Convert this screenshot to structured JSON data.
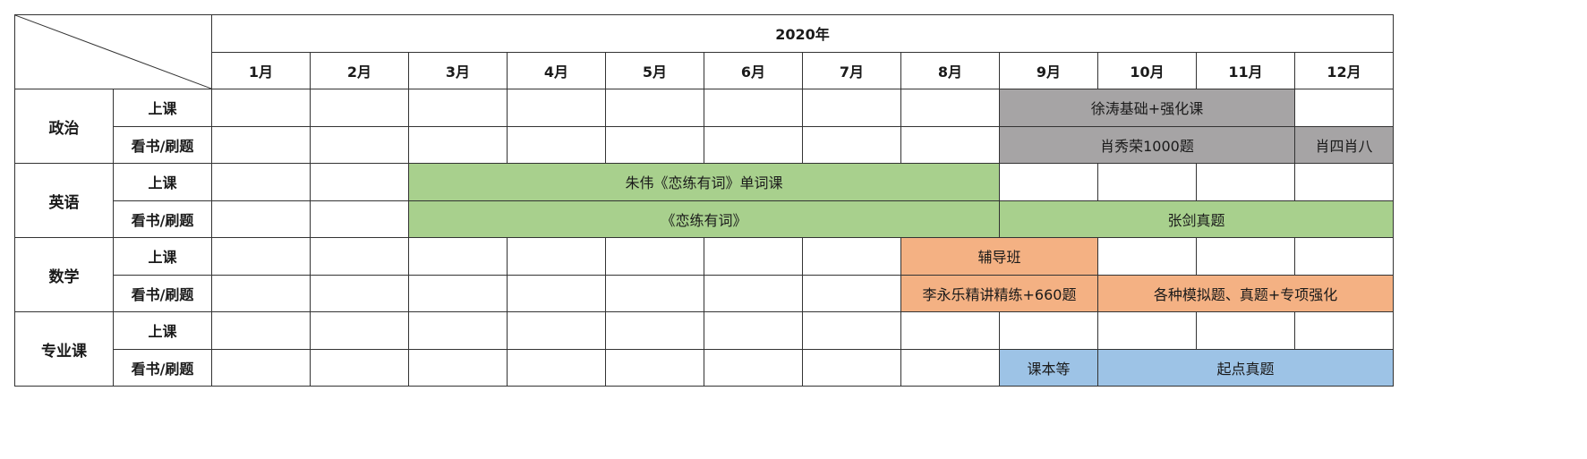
{
  "year": "2020年",
  "months": [
    "1月",
    "2月",
    "3月",
    "4月",
    "5月",
    "6月",
    "7月",
    "8月",
    "9月",
    "10月",
    "11月",
    "12月"
  ],
  "row_labels": {
    "class": "上课",
    "study": "看书/刷题"
  },
  "subjects": [
    {
      "name": "政治",
      "rows": [
        {
          "cells": [
            null,
            null,
            null,
            null,
            null,
            null,
            null,
            null,
            {
              "text": "徐涛基础+强化课",
              "span": 3,
              "color": "#a6a4a5"
            },
            null
          ]
        },
        {
          "cells": [
            null,
            null,
            null,
            null,
            null,
            null,
            null,
            null,
            {
              "text": "肖秀荣1000题",
              "span": 3,
              "color": "#a6a4a5"
            },
            {
              "text": "肖四肖八",
              "span": 1,
              "color": "#a6a4a5"
            }
          ]
        }
      ]
    },
    {
      "name": "英语",
      "rows": [
        {
          "cells": [
            null,
            null,
            {
              "text": "朱伟《恋练有词》单词课",
              "span": 6,
              "color": "#a8d08d"
            },
            null,
            null,
            null,
            null
          ]
        },
        {
          "cells": [
            null,
            null,
            {
              "text": "《恋练有词》",
              "span": 6,
              "color": "#a8d08d"
            },
            {
              "text": "张剑真题",
              "span": 4,
              "color": "#a8d08d"
            }
          ]
        }
      ]
    },
    {
      "name": "数学",
      "rows": [
        {
          "cells": [
            null,
            null,
            null,
            null,
            null,
            null,
            null,
            {
              "text": "辅导班",
              "span": 2,
              "color": "#f4b183"
            },
            null,
            null,
            null
          ]
        },
        {
          "cells": [
            null,
            null,
            null,
            null,
            null,
            null,
            null,
            {
              "text": "李永乐精讲精练+660题",
              "span": 2,
              "color": "#f4b183"
            },
            {
              "text": "各种模拟题、真题+专项强化",
              "span": 3,
              "color": "#f4b183"
            }
          ]
        }
      ]
    },
    {
      "name": "专业课",
      "rows": [
        {
          "cells": [
            null,
            null,
            null,
            null,
            null,
            null,
            null,
            null,
            null,
            null,
            null,
            null
          ]
        },
        {
          "cells": [
            null,
            null,
            null,
            null,
            null,
            null,
            null,
            null,
            {
              "text": "课本等",
              "span": 1,
              "color": "#9dc3e6"
            },
            {
              "text": "起点真题",
              "span": 3,
              "color": "#9dc3e6"
            }
          ]
        }
      ]
    }
  ]
}
